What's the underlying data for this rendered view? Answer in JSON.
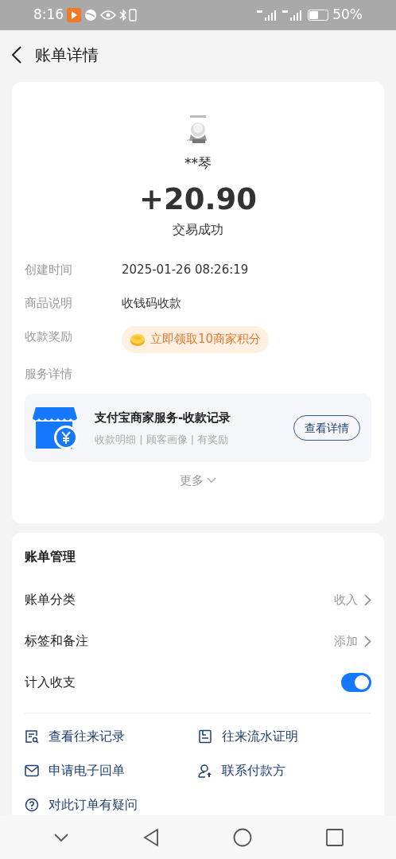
{
  "status_bar": {
    "time": "8:16",
    "battery_text": "50%"
  },
  "header": {
    "title": "账单详情"
  },
  "summary": {
    "name": "**琴",
    "amount": "+20.90",
    "status": "交易成功"
  },
  "details": [
    {
      "kind": "text",
      "label": "创建时间",
      "value": "2025-01-26 08:26:19"
    },
    {
      "kind": "text",
      "label": "商品说明",
      "value": "收钱码收款"
    },
    {
      "kind": "reward",
      "label": "收款奖励",
      "value": "立即领取10商家积分"
    }
  ],
  "service": {
    "label": "服务详情",
    "title": "支付宝商家服务-收款记录",
    "subtitle": "收款明细 | 顾客画像 | 有奖励",
    "button": "查看详情"
  },
  "more": "更多",
  "management": {
    "title": "账单管理",
    "rows": [
      {
        "kind": "link",
        "label": "账单分类",
        "value": "收入"
      },
      {
        "kind": "link",
        "label": "标签和备注",
        "value": "添加"
      },
      {
        "kind": "toggle",
        "label": "计入收支",
        "on": true
      }
    ],
    "actions": [
      {
        "kind": "records",
        "label": "查看往来记录"
      },
      {
        "kind": "proof",
        "label": "往来流水证明"
      },
      {
        "kind": "mail",
        "label": "申请电子回单"
      },
      {
        "kind": "contact",
        "label": "联系付款方"
      },
      {
        "kind": "question",
        "label": "对此订单有疑问"
      }
    ]
  }
}
